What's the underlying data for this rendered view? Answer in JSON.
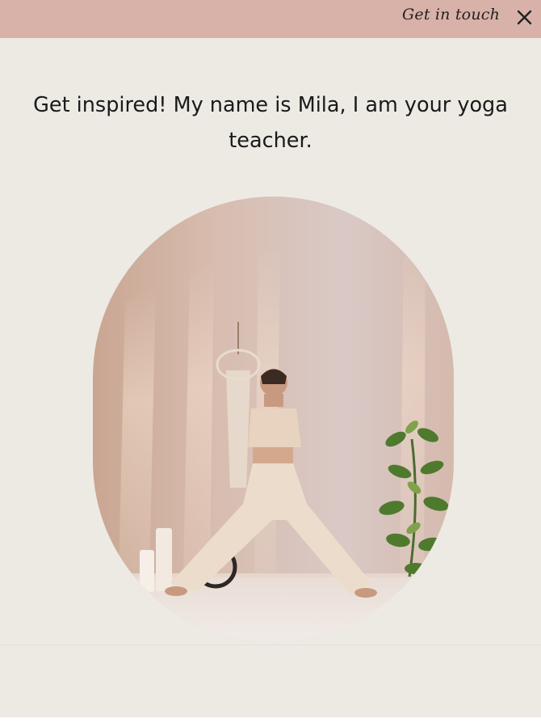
{
  "topbar": {
    "cta_label": "Get in touch",
    "close_icon": "close-icon",
    "background": "#d8b1a8"
  },
  "hero": {
    "headline_line1": "Get inspired! My name is Mila, I am your yoga",
    "headline_line2": "teacher."
  },
  "colors": {
    "page_background": "#edeae4",
    "text": "#1a1a1a"
  }
}
